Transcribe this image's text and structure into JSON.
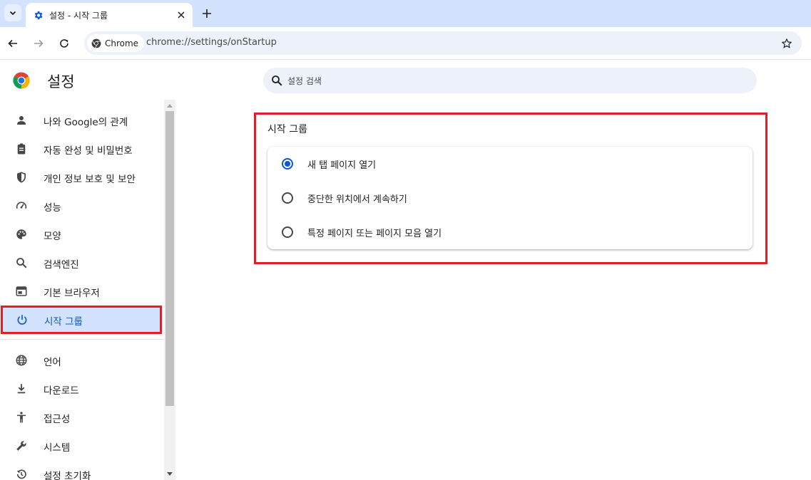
{
  "tab": {
    "title": "설정 - 시작 그룹"
  },
  "toolbar": {
    "chip_label": "Chrome",
    "url": "chrome://settings/onStartup"
  },
  "header": {
    "title": "설정",
    "search_placeholder": "설정 검색"
  },
  "sidebar": {
    "items": [
      {
        "label": "나와 Google의 관계",
        "icon": "person-icon"
      },
      {
        "label": "자동 완성 및 비밀번호",
        "icon": "clipboard-icon"
      },
      {
        "label": "개인 정보 보호 및 보안",
        "icon": "shield-icon"
      },
      {
        "label": "성능",
        "icon": "speedometer-icon"
      },
      {
        "label": "모양",
        "icon": "palette-icon"
      },
      {
        "label": "검색엔진",
        "icon": "search-icon"
      },
      {
        "label": "기본 브라우저",
        "icon": "browser-window-icon"
      },
      {
        "label": "시작 그룹",
        "icon": "power-icon",
        "active": true
      },
      {
        "label": "언어",
        "icon": "globe-icon"
      },
      {
        "label": "다운로드",
        "icon": "download-icon"
      },
      {
        "label": "접근성",
        "icon": "accessibility-icon"
      },
      {
        "label": "시스템",
        "icon": "wrench-icon"
      },
      {
        "label": "설정 초기화",
        "icon": "history-reset-icon"
      }
    ]
  },
  "main": {
    "section_title": "시작 그룹",
    "options": [
      {
        "label": "새 탭 페이지 열기",
        "checked": true
      },
      {
        "label": "중단한 위치에서 계속하기",
        "checked": false
      },
      {
        "label": "특정 페이지 또는 페이지 모음 열기",
        "checked": false
      }
    ]
  },
  "colors": {
    "accent": "#0b57d0",
    "highlight_frame": "#e01f26",
    "tabstrip": "#d3e3fd",
    "omnibox": "#edf2fa"
  }
}
